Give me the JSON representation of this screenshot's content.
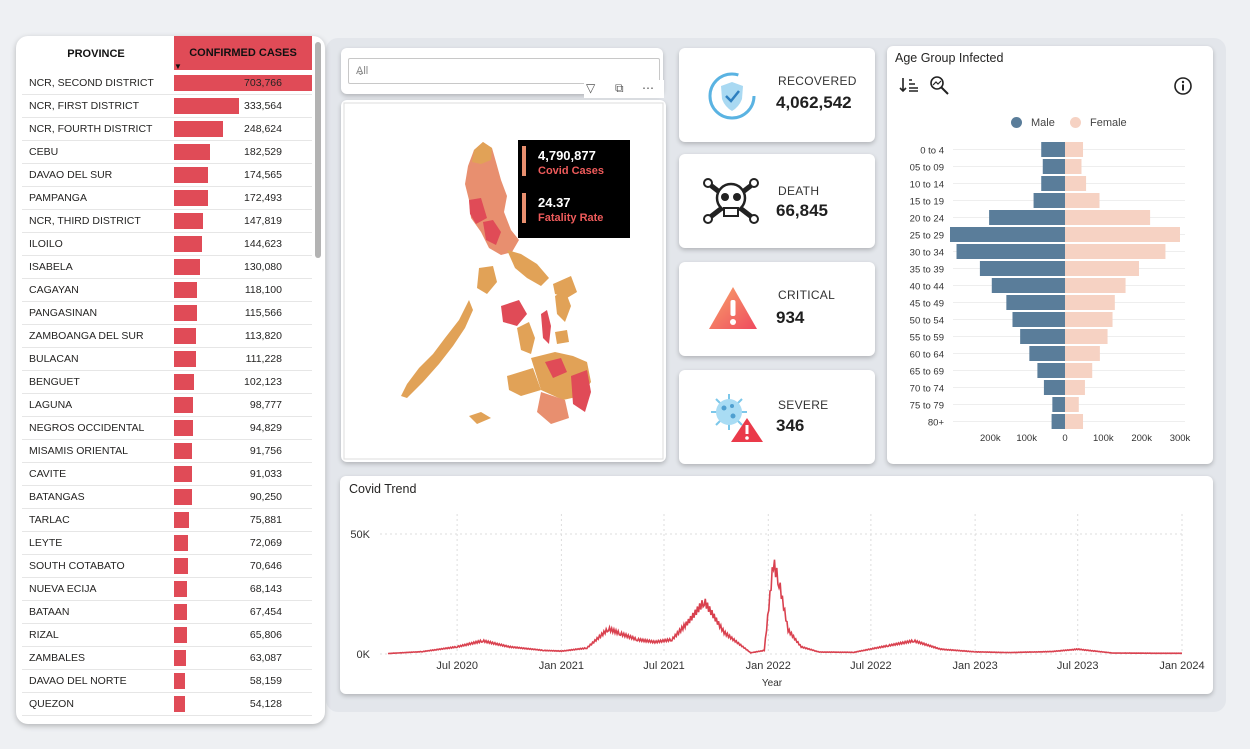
{
  "province_table": {
    "header_province": "PROVINCE",
    "header_cases": "CONFIRMED CASES",
    "max_value": 703766,
    "rows": [
      {
        "name": "NCR, SECOND DISTRICT",
        "value": 703766,
        "label": "703,766"
      },
      {
        "name": "NCR, FIRST DISTRICT",
        "value": 333564,
        "label": "333,564"
      },
      {
        "name": "NCR, FOURTH DISTRICT",
        "value": 248624,
        "label": "248,624"
      },
      {
        "name": "CEBU",
        "value": 182529,
        "label": "182,529"
      },
      {
        "name": "DAVAO DEL SUR",
        "value": 174565,
        "label": "174,565"
      },
      {
        "name": "PAMPANGA",
        "value": 172493,
        "label": "172,493"
      },
      {
        "name": "NCR, THIRD DISTRICT",
        "value": 147819,
        "label": "147,819"
      },
      {
        "name": "ILOILO",
        "value": 144623,
        "label": "144,623"
      },
      {
        "name": "ISABELA",
        "value": 130080,
        "label": "130,080"
      },
      {
        "name": "CAGAYAN",
        "value": 118100,
        "label": "118,100"
      },
      {
        "name": "PANGASINAN",
        "value": 115566,
        "label": "115,566"
      },
      {
        "name": "ZAMBOANGA DEL SUR",
        "value": 113820,
        "label": "113,820"
      },
      {
        "name": "BULACAN",
        "value": 111228,
        "label": "111,228"
      },
      {
        "name": "BENGUET",
        "value": 102123,
        "label": "102,123"
      },
      {
        "name": "LAGUNA",
        "value": 98777,
        "label": "98,777"
      },
      {
        "name": "NEGROS OCCIDENTAL",
        "value": 94829,
        "label": "94,829"
      },
      {
        "name": "MISAMIS ORIENTAL",
        "value": 91756,
        "label": "91,756"
      },
      {
        "name": "CAVITE",
        "value": 91033,
        "label": "91,033"
      },
      {
        "name": "BATANGAS",
        "value": 90250,
        "label": "90,250"
      },
      {
        "name": "TARLAC",
        "value": 75881,
        "label": "75,881"
      },
      {
        "name": "LEYTE",
        "value": 72069,
        "label": "72,069"
      },
      {
        "name": "SOUTH COTABATO",
        "value": 70646,
        "label": "70,646"
      },
      {
        "name": "NUEVA ECIJA",
        "value": 68143,
        "label": "68,143"
      },
      {
        "name": "BATAAN",
        "value": 67454,
        "label": "67,454"
      },
      {
        "name": "RIZAL",
        "value": 65806,
        "label": "65,806"
      },
      {
        "name": "ZAMBALES",
        "value": 63087,
        "label": "63,087"
      },
      {
        "name": "DAVAO DEL NORTE",
        "value": 58159,
        "label": "58,159"
      },
      {
        "name": "QUEZON",
        "value": 54128,
        "label": "54,128"
      }
    ]
  },
  "slicer": {
    "value": "All"
  },
  "map": {
    "tooltip": {
      "cases_value": "4,790,877",
      "cases_label": "Covid Cases",
      "fatality_value": "24.37",
      "fatality_label": "Fatality Rate"
    }
  },
  "kpis": {
    "recovered": {
      "label": "RECOVERED",
      "value": "4,062,542",
      "icon": "shield-check-icon"
    },
    "death": {
      "label": "DEATH",
      "value": "66,845",
      "icon": "skull-crossbones-icon"
    },
    "critical": {
      "label": "CRITICAL",
      "value": "934",
      "icon": "warning-triangle-icon"
    },
    "severe": {
      "label": "SEVERE",
      "value": "346",
      "icon": "virus-alert-icon"
    }
  },
  "colors": {
    "accent_red": "#e04b57",
    "male": "#5a7d9a",
    "female": "#f6d2c3",
    "trend_line": "#d9414f"
  },
  "chart_data": [
    {
      "type": "bar",
      "orientation": "horizontal-diverging",
      "title": "Age Group Infected",
      "categories": [
        "0 to 4",
        "05 to 09",
        "10 to 14",
        "15 to 19",
        "20 to 24",
        "25 to 29",
        "30 to 34",
        "35 to 39",
        "40 to 44",
        "45 to 49",
        "50 to 54",
        "55 to 59",
        "60 to 64",
        "65 to 69",
        "70 to 74",
        "75 to 79",
        "80+"
      ],
      "series": [
        {
          "name": "Male",
          "values": [
            62000,
            58000,
            62000,
            82000,
            198000,
            300000,
            283000,
            222000,
            191000,
            153000,
            137000,
            117000,
            93000,
            72000,
            55000,
            33000,
            35000
          ]
        },
        {
          "name": "Female",
          "values": [
            47000,
            43000,
            55000,
            90000,
            222000,
            300000,
            262000,
            193000,
            158000,
            130000,
            124000,
            111000,
            91000,
            71000,
            52000,
            36000,
            47000
          ]
        }
      ],
      "x_ticks": [
        "200k",
        "100k",
        "0",
        "100k",
        "200k",
        "300k"
      ],
      "xlim": [
        -300000,
        300000
      ],
      "legend_position": "top"
    },
    {
      "type": "line",
      "title": "Covid Trend",
      "xlabel": "Year",
      "x_ticks": [
        "Jul 2020",
        "Jan 2021",
        "Jul 2021",
        "Jan 2022",
        "Jul 2022",
        "Jan 2023",
        "Jul 2023",
        "Jan 2024"
      ],
      "y_ticks": [
        "0K",
        "50K"
      ],
      "ylim": [
        0,
        50000
      ],
      "series": [
        {
          "x": [
            "2020-03-01",
            "2020-05-01",
            "2020-07-01",
            "2020-08-15",
            "2020-10-01",
            "2020-12-01",
            "2021-01-01",
            "2021-02-15",
            "2021-03-25",
            "2021-04-15",
            "2021-05-15",
            "2021-06-15",
            "2021-07-15",
            "2021-08-15",
            "2021-09-10",
            "2021-10-15",
            "2021-12-01",
            "2021-12-25",
            "2022-01-10",
            "2022-01-20",
            "2022-02-05",
            "2022-02-28",
            "2022-04-01",
            "2022-06-01",
            "2022-08-01",
            "2022-09-15",
            "2022-11-01",
            "2023-01-01",
            "2023-03-01",
            "2023-05-15",
            "2023-07-01",
            "2023-09-01",
            "2023-12-01",
            "2024-01-01"
          ],
          "y": [
            200,
            1000,
            3000,
            5500,
            3000,
            1500,
            1200,
            2500,
            10500,
            8500,
            6000,
            5000,
            6000,
            14000,
            22000,
            9000,
            500,
            1500,
            38000,
            30000,
            10000,
            3000,
            800,
            700,
            3500,
            5500,
            2000,
            900,
            600,
            1000,
            2000,
            400,
            300,
            300
          ]
        }
      ]
    }
  ]
}
